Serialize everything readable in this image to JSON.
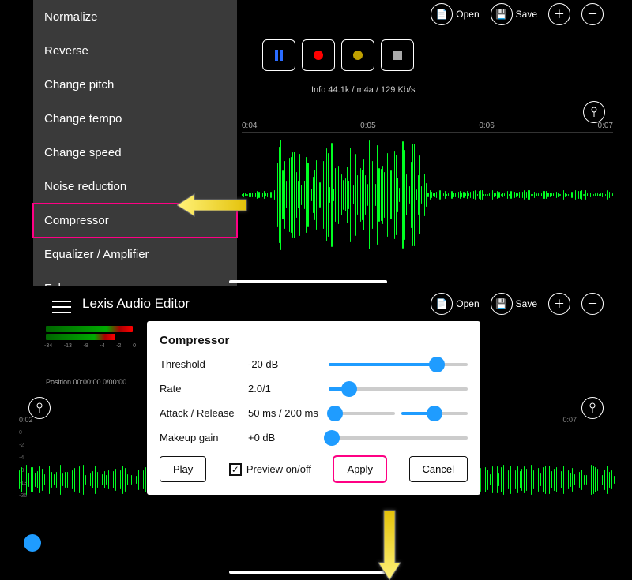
{
  "menu": {
    "items": [
      {
        "label": "Normalize"
      },
      {
        "label": "Reverse"
      },
      {
        "label": "Change pitch"
      },
      {
        "label": "Change tempo"
      },
      {
        "label": "Change speed"
      },
      {
        "label": "Noise reduction"
      },
      {
        "label": "Compressor"
      },
      {
        "label": "Equalizer / Amplifier"
      },
      {
        "label": "Echo"
      }
    ]
  },
  "toolbar": {
    "open": "Open",
    "save": "Save"
  },
  "info": "Info   44.1k / m4a / 129 Kb/s",
  "axis1": {
    "t1": "0:04",
    "t2": "0:05",
    "t3": "0:06",
    "t4": "0:07"
  },
  "app_title": "Lexis Audio Editor",
  "meter_ticks": [
    "-34",
    "-13",
    "-8",
    "-4",
    "-2",
    "0"
  ],
  "position": "Position  00:00:00.0/00:00",
  "axis2": {
    "tA": "0:02",
    "tB": "0:07"
  },
  "scale": [
    "0",
    "-2",
    "-4",
    "-8",
    "-13",
    "-36"
  ],
  "dialog": {
    "title": "Compressor",
    "threshold_label": "Threshold",
    "threshold_value": "-20 dB",
    "rate_label": "Rate",
    "rate_value": "2.0/1",
    "ar_label": "Attack / Release",
    "ar_value": "50 ms   /   200 ms",
    "makeup_label": "Makeup gain",
    "makeup_value": "+0 dB",
    "play": "Play",
    "preview": "Preview on/off",
    "apply": "Apply",
    "cancel": "Cancel"
  }
}
